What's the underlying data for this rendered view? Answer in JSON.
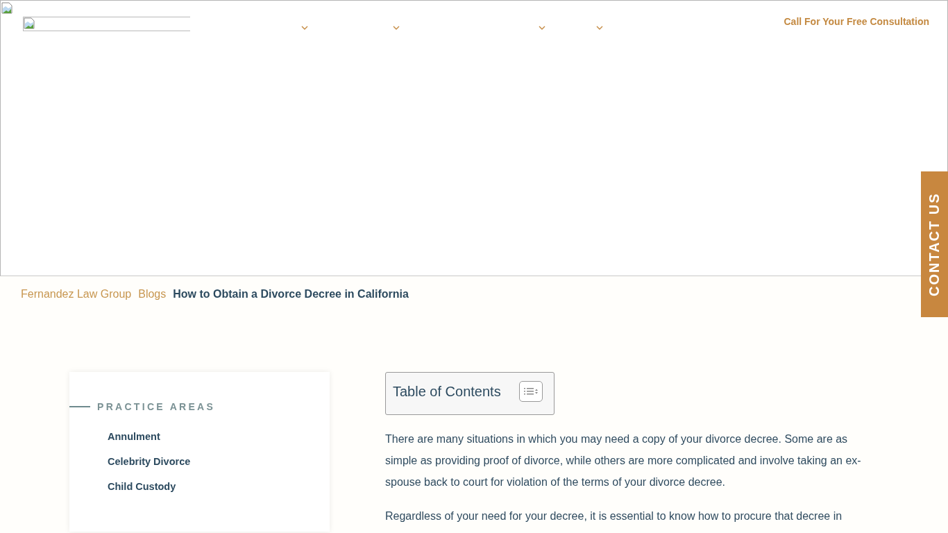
{
  "header": {
    "nav_menus": [
      {
        "expanded": false
      },
      {
        "expanded": false
      },
      {
        "expanded": false
      },
      {
        "expanded": false
      }
    ],
    "cta": "Call For Your Free Consultation"
  },
  "contact_tab": "CONTACT US",
  "breadcrumb": [
    {
      "label": "Fernandez Law Group",
      "kind": "link"
    },
    {
      "label": "Blogs",
      "kind": "link"
    },
    {
      "label": "How to Obtain a Divorce Decree in California",
      "kind": "current"
    }
  ],
  "sidebar": {
    "heading": "PRACTICE AREAS",
    "items": [
      "Annulment",
      "Celebrity Divorce",
      "Child Custody"
    ]
  },
  "toc": {
    "title": "Table of Contents",
    "expanded": false
  },
  "paragraphs": [
    "There are many situations in which you may need a copy of your divorce decree. Some are as simple as providing proof of divorce, while others are more complicated and involve taking an ex-spouse back to court for violation of the terms of your divorce decree.",
    "Regardless of your need for your decree, it is essential to know how to procure that decree in"
  ]
}
